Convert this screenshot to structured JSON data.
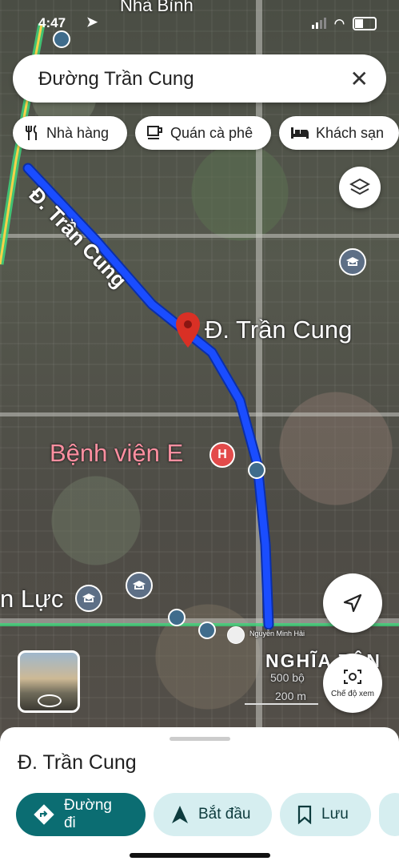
{
  "status": {
    "time": "4:47"
  },
  "map_top_label": "Nhà Bình",
  "search": {
    "query": "Đường Trần Cung"
  },
  "chips": [
    {
      "label": "Nhà hàng",
      "icon": "fork-knife-icon"
    },
    {
      "label": "Quán cà phê",
      "icon": "coffee-cup-icon"
    },
    {
      "label": "Khách sạn",
      "icon": "bed-icon"
    }
  ],
  "map": {
    "road_label": "Đ. Trần Cung",
    "pin_label": "Đ. Trần Cung",
    "hospital_label": "Bệnh viện E",
    "left_label": "n Lực",
    "district_label": "NGHĨA TÂN",
    "user_credit": "Nguyễn Minh Hải",
    "scale_ft": "500 bộ",
    "scale_m": "200 m",
    "route_color": "#1a4dff"
  },
  "street_view_label": "Chế độ xem",
  "sheet": {
    "place_name": "Đ. Trần Cung",
    "buttons": [
      {
        "label": "Đường đi"
      },
      {
        "label": "Bắt đầu"
      },
      {
        "label": "Lưu"
      }
    ]
  },
  "colors": {
    "primary": "#0b6d72",
    "secondary_bg": "#d6eef0",
    "pin": "#d93025"
  }
}
